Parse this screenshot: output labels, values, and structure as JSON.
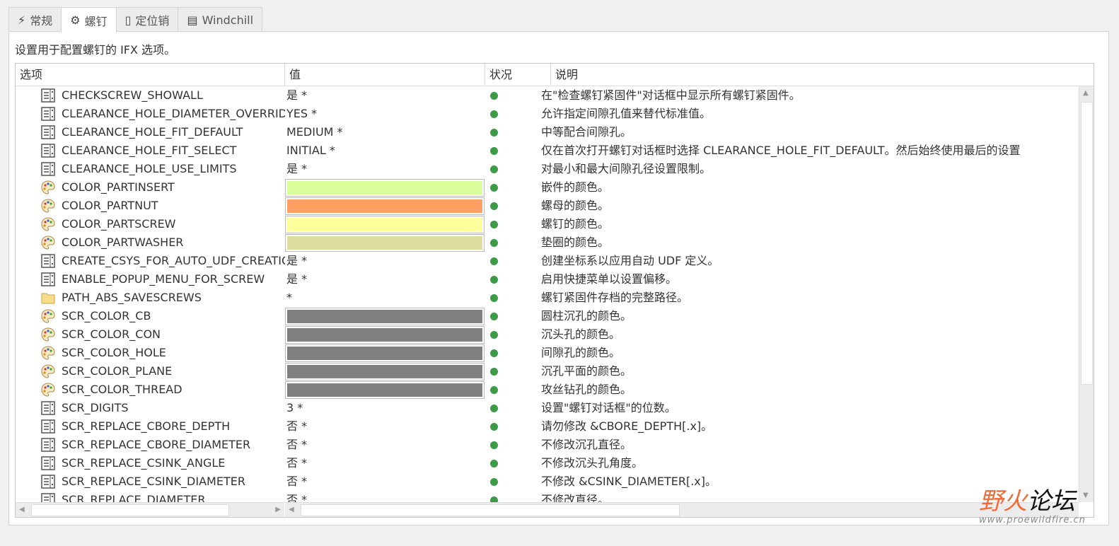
{
  "tabs": [
    {
      "label": "常规",
      "icon": "lightning-icon"
    },
    {
      "label": "螺钉",
      "icon": "screw-icon",
      "active": true
    },
    {
      "label": "定位销",
      "icon": "pin-icon"
    },
    {
      "label": "Windchill",
      "icon": "cabinet-icon"
    }
  ],
  "description": "设置用于配置螺钉的 IFX 选项。",
  "columns": [
    "选项",
    "值",
    "状况",
    "说明"
  ],
  "status_color": "#3d9a47",
  "rows": [
    {
      "icon": "list",
      "name": "CHECKSCREW_SHOWALL",
      "value": "是 *",
      "desc": "在\"检查螺钉紧固件\"对话框中显示所有螺钉紧固件。"
    },
    {
      "icon": "list",
      "name": "CLEARANCE_HOLE_DIAMETER_OVERRIDE",
      "value": "YES *",
      "desc": "允许指定间隙孔值来替代标准值。"
    },
    {
      "icon": "list",
      "name": "CLEARANCE_HOLE_FIT_DEFAULT",
      "value": "MEDIUM *",
      "desc": "中等配合间隙孔。"
    },
    {
      "icon": "list",
      "name": "CLEARANCE_HOLE_FIT_SELECT",
      "value": "INITIAL *",
      "desc": "仅在首次打开螺钉对话框时选择 CLEARANCE_HOLE_FIT_DEFAULT。然后始终使用最后的设置"
    },
    {
      "icon": "list",
      "name": "CLEARANCE_HOLE_USE_LIMITS",
      "value": "是 *",
      "desc": "对最小和最大间隙孔径设置限制。"
    },
    {
      "icon": "palette",
      "name": "COLOR_PARTINSERT",
      "color": "#dbfe9c",
      "desc": "嵌件的颜色。"
    },
    {
      "icon": "palette",
      "name": "COLOR_PARTNUT",
      "color": "#fea064",
      "desc": "螺母的颜色。"
    },
    {
      "icon": "palette",
      "name": "COLOR_PARTSCREW",
      "color": "#fefe9c",
      "desc": "螺钉的颜色。"
    },
    {
      "icon": "palette",
      "name": "COLOR_PARTWASHER",
      "color": "#dcdc9e",
      "desc": "垫圈的颜色。"
    },
    {
      "icon": "list",
      "name": "CREATE_CSYS_FOR_AUTO_UDF_CREATION",
      "value": "是 *",
      "desc": "创建坐标系以应用自动 UDF 定义。"
    },
    {
      "icon": "list",
      "name": "ENABLE_POPUP_MENU_FOR_SCREW",
      "value": "是 *",
      "desc": "启用快捷菜单以设置偏移。"
    },
    {
      "icon": "folder",
      "name": "PATH_ABS_SAVESCREWS",
      "value": " *",
      "desc": "螺钉紧固件存档的完整路径。"
    },
    {
      "icon": "palette",
      "name": "SCR_COLOR_CB",
      "color": "#808080",
      "desc": "圆柱沉孔的颜色。"
    },
    {
      "icon": "palette",
      "name": "SCR_COLOR_CON",
      "color": "#808080",
      "desc": "沉头孔的颜色。"
    },
    {
      "icon": "palette",
      "name": "SCR_COLOR_HOLE",
      "color": "#808080",
      "desc": "间隙孔的颜色。"
    },
    {
      "icon": "palette",
      "name": "SCR_COLOR_PLANE",
      "color": "#808080",
      "desc": "沉孔平面的颜色。"
    },
    {
      "icon": "palette",
      "name": "SCR_COLOR_THREAD",
      "color": "#808080",
      "desc": "攻丝钻孔的颜色。"
    },
    {
      "icon": "list",
      "name": "SCR_DIGITS",
      "value": "3 *",
      "desc": "设置\"螺钉对话框\"的位数。"
    },
    {
      "icon": "list",
      "name": "SCR_REPLACE_CBORE_DEPTH",
      "value": "否 *",
      "desc": "请勿修改 &CBORE_DEPTH[.x]。"
    },
    {
      "icon": "list",
      "name": "SCR_REPLACE_CBORE_DIAMETER",
      "value": "否 *",
      "desc": "不修改沉孔直径。"
    },
    {
      "icon": "list",
      "name": "SCR_REPLACE_CSINK_ANGLE",
      "value": "否 *",
      "desc": "不修改沉头孔角度。"
    },
    {
      "icon": "list",
      "name": "SCR_REPLACE_CSINK_DIAMETER",
      "value": "否 *",
      "desc": "不修改 &CSINK_DIAMETER[.x]。"
    },
    {
      "icon": "list",
      "name": "SCR_REPLACE_DIAMETER",
      "value": "否 *",
      "desc": "不修改直径。"
    }
  ],
  "watermark": {
    "logo": "野火论坛",
    "url": "www.proewildfire.cn"
  }
}
